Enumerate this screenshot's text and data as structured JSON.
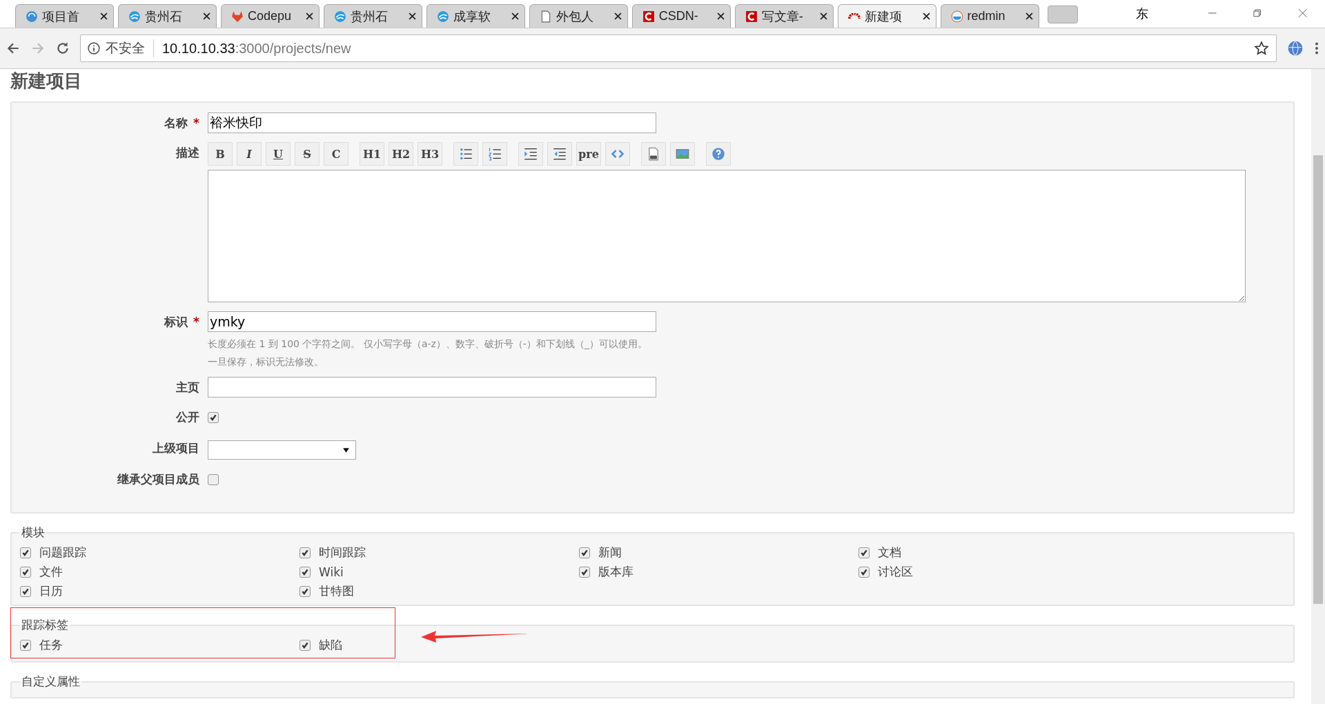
{
  "browser": {
    "tabs": [
      {
        "title": "项目首",
        "selected": false
      },
      {
        "title": "贵州石",
        "selected": false
      },
      {
        "title": "Codepu",
        "selected": false
      },
      {
        "title": "贵州石",
        "selected": false
      },
      {
        "title": "成享软",
        "selected": false
      },
      {
        "title": "外包人",
        "selected": false
      },
      {
        "title": "CSDN-",
        "selected": false
      },
      {
        "title": "写文章-",
        "selected": false
      },
      {
        "title": "新建项",
        "selected": true
      },
      {
        "title": "redmin",
        "selected": false
      }
    ],
    "profile": "东",
    "security": "不安全",
    "url_host": "10.10.10.33",
    "url_rest": ":3000/projects/new"
  },
  "page": {
    "title": "新建项目",
    "fields": [
      {
        "kind": "text",
        "label": "名称",
        "required_mark": "*",
        "value": "裕米快印"
      },
      {
        "kind": "editor",
        "label": "描述",
        "toolbar": [
          [
            {
              "kind": "bold",
              "label": "B"
            },
            {
              "kind": "italic",
              "label": "I"
            },
            {
              "kind": "underline",
              "label": "U"
            },
            {
              "kind": "strike",
              "label": "S"
            },
            {
              "kind": "plain",
              "label": "C"
            }
          ],
          [
            {
              "kind": "plain",
              "label": "H1"
            },
            {
              "kind": "plain",
              "label": "H2"
            },
            {
              "kind": "plain",
              "label": "H3"
            }
          ],
          [
            {
              "kind": "ul"
            },
            {
              "kind": "ol"
            }
          ],
          [
            {
              "kind": "indent"
            },
            {
              "kind": "outdent"
            },
            {
              "kind": "plain",
              "label": "pre"
            },
            {
              "kind": "code"
            }
          ],
          [
            {
              "kind": "file"
            },
            {
              "kind": "image"
            }
          ],
          [
            {
              "kind": "help"
            }
          ]
        ]
      },
      {
        "kind": "text",
        "label": "标识",
        "required_mark": "*",
        "value": "ymky",
        "hints": [
          "长度必须在 1 到 100 个字符之间。 仅小写字母（a-z）、数字、破折号（-）和下划线（_）可以使用。",
          "一旦保存，标识无法修改。"
        ]
      },
      {
        "kind": "text",
        "label": "主页"
      },
      {
        "kind": "checkbox",
        "label": "公开",
        "checked": true
      },
      {
        "kind": "select",
        "label": "上级项目"
      },
      {
        "kind": "checkbox",
        "label": "继承父项目成员",
        "checked": false
      }
    ],
    "modules": {
      "legend": "模块",
      "items": [
        {
          "label": "问题跟踪",
          "checked": true
        },
        {
          "label": "时间跟踪",
          "checked": true
        },
        {
          "label": "新闻",
          "checked": true
        },
        {
          "label": "文档",
          "checked": true
        },
        {
          "label": "文件",
          "checked": true
        },
        {
          "label": "Wiki",
          "checked": true
        },
        {
          "label": "版本库",
          "checked": true
        },
        {
          "label": "讨论区",
          "checked": true
        },
        {
          "label": "日历",
          "checked": true
        },
        {
          "label": "甘特图",
          "checked": true
        }
      ]
    },
    "trackers": {
      "legend": "跟踪标签",
      "highlighted": true,
      "items": [
        {
          "label": "任务",
          "checked": true
        },
        {
          "label": "缺陷",
          "checked": true
        }
      ]
    },
    "custom_fields": {
      "legend": "自定义属性"
    }
  }
}
